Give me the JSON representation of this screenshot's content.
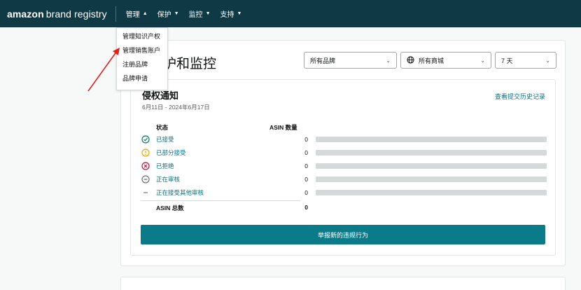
{
  "brand": {
    "part1": "amazon",
    "part2": "brand registry"
  },
  "nav": [
    {
      "label": "管理"
    },
    {
      "label": "保护"
    },
    {
      "label": "监控"
    },
    {
      "label": "支持"
    }
  ],
  "dropdown": {
    "items": [
      {
        "label": "管理知识产权"
      },
      {
        "label": "管理销售账户"
      },
      {
        "label": "注册品牌"
      },
      {
        "label": "品牌申请"
      }
    ]
  },
  "page": {
    "title": "护和监控",
    "filters": {
      "brand": "所有品牌",
      "marketplace": "所有商城",
      "range": "7 天"
    }
  },
  "infringement": {
    "title": "侵权通知",
    "date_range": "6月11日 - 2024年6月17日",
    "history_link": "查看提交历史记录",
    "col_status": "状态",
    "col_count": "ASIN 数量",
    "rows": [
      {
        "label": "已接受",
        "count": "0",
        "icon": "check-circle-icon",
        "color": "#067d62",
        "share": 0
      },
      {
        "label": "已部分接受",
        "count": "0",
        "icon": "warning-circle-icon",
        "color": "#f0a500",
        "share": 0
      },
      {
        "label": "已拒绝",
        "count": "0",
        "icon": "x-circle-icon",
        "color": "#cc0c39",
        "share": 0
      },
      {
        "label": "正在审核",
        "count": "0",
        "icon": "minus-circle-icon",
        "color": "#6f7373",
        "share": 0
      },
      {
        "label": "正在接受其他审核",
        "count": "0",
        "icon": "dash-icon",
        "color": "#6f7373",
        "share": 0
      }
    ],
    "total_label": "ASIN 总数",
    "total_value": "0",
    "cta": "举报新的违规行为"
  },
  "colors": {
    "topbar": "#0f3a45",
    "accent": "#007185",
    "cta": "#0b7b8a",
    "arrow": "#e0201b"
  }
}
